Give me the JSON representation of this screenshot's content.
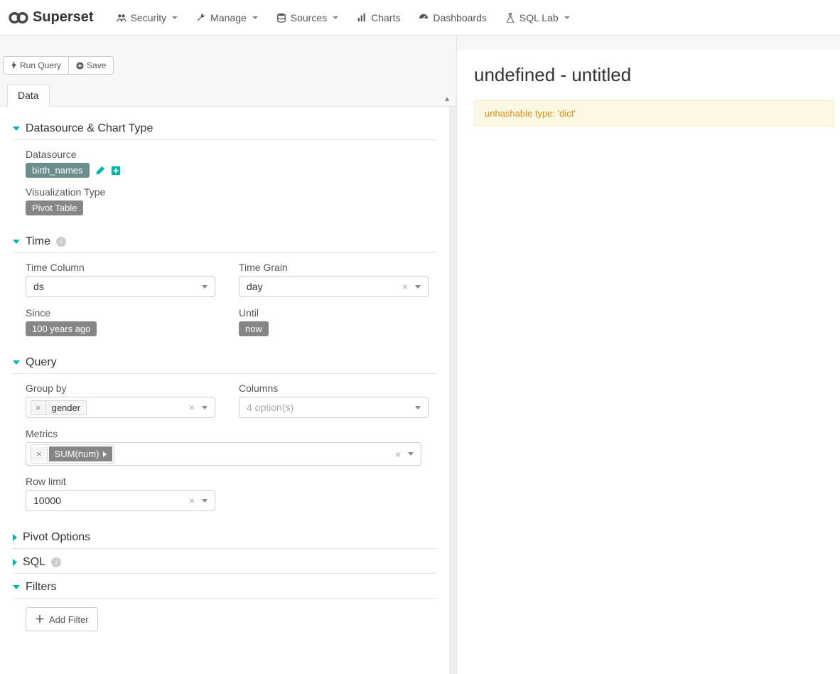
{
  "brand": "Superset",
  "nav": {
    "security": "Security",
    "manage": "Manage",
    "sources": "Sources",
    "charts": "Charts",
    "dashboards": "Dashboards",
    "sqllab": "SQL Lab"
  },
  "toolbar": {
    "run": "Run Query",
    "save": "Save"
  },
  "tabs": {
    "data": "Data"
  },
  "sections": {
    "datasource": {
      "title": "Datasource & Chart Type",
      "ds_label": "Datasource",
      "ds_value": "birth_names",
      "viz_label": "Visualization Type",
      "viz_value": "Pivot Table"
    },
    "time": {
      "title": "Time",
      "col_label": "Time Column",
      "col_value": "ds",
      "grain_label": "Time Grain",
      "grain_value": "day",
      "since_label": "Since",
      "since_value": "100 years ago",
      "until_label": "Until",
      "until_value": "now"
    },
    "query": {
      "title": "Query",
      "groupby_label": "Group by",
      "groupby_value": "gender",
      "columns_label": "Columns",
      "columns_placeholder": "4 option(s)",
      "metrics_label": "Metrics",
      "metrics_value": "SUM(num)",
      "rowlimit_label": "Row limit",
      "rowlimit_value": "10000"
    },
    "pivot": {
      "title": "Pivot Options"
    },
    "sql": {
      "title": "SQL"
    },
    "filters": {
      "title": "Filters",
      "add_label": "Add Filter"
    }
  },
  "chart": {
    "title": "undefined - untitled",
    "error": "unhashable type: 'dict'"
  }
}
